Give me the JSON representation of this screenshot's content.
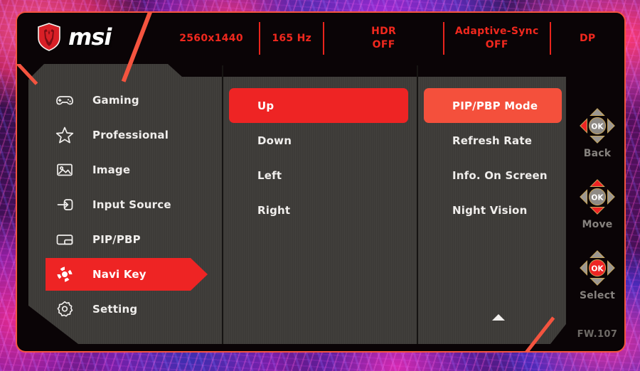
{
  "brand": {
    "logo_icon": "msi-dragon-shield-icon",
    "wordmark": "msi"
  },
  "status_bar": {
    "resolution": "2560x1440",
    "refresh_rate": "165 Hz",
    "hdr_label": "HDR",
    "hdr_value": "OFF",
    "adaptive_sync_label": "Adaptive-Sync",
    "adaptive_sync_value": "OFF",
    "input_source": "DP"
  },
  "sidebar": {
    "items": [
      {
        "label": "Gaming",
        "icon": "gamepad-icon",
        "selected": false
      },
      {
        "label": "Professional",
        "icon": "star-icon",
        "selected": false
      },
      {
        "label": "Image",
        "icon": "picture-icon",
        "selected": false
      },
      {
        "label": "Input Source",
        "icon": "input-arrow-icon",
        "selected": false
      },
      {
        "label": "PIP/PBP",
        "icon": "pip-pbp-icon",
        "selected": false
      },
      {
        "label": "Navi Key",
        "icon": "navi-key-icon",
        "selected": true
      },
      {
        "label": "Setting",
        "icon": "gear-icon",
        "selected": false
      }
    ]
  },
  "column_two": {
    "items": [
      {
        "label": "Up",
        "selected": true
      },
      {
        "label": "Down",
        "selected": false
      },
      {
        "label": "Left",
        "selected": false
      },
      {
        "label": "Right",
        "selected": false
      }
    ]
  },
  "column_three": {
    "items": [
      {
        "label": "PIP/PBP Mode",
        "selected": true
      },
      {
        "label": "Refresh Rate",
        "selected": false
      },
      {
        "label": "Info. On Screen",
        "selected": false
      },
      {
        "label": "Night Vision",
        "selected": false
      }
    ],
    "scroll_up_icon": "triangle-up-icon"
  },
  "nav_hints": {
    "items": [
      {
        "label": "Back",
        "icon": "joystick-left-icon",
        "highlight": "left"
      },
      {
        "label": "Move",
        "icon": "joystick-updown-icon",
        "highlight": "updown"
      },
      {
        "label": "Select",
        "icon": "joystick-ok-icon",
        "highlight": "center"
      }
    ],
    "firmware": "FW.107"
  },
  "colors": {
    "accent_red": "#ee2424",
    "accent_salmon": "#f4543f",
    "panel_gray": "#3d3b38",
    "frame_black": "#0a0406",
    "status_text": "#f0281e"
  }
}
